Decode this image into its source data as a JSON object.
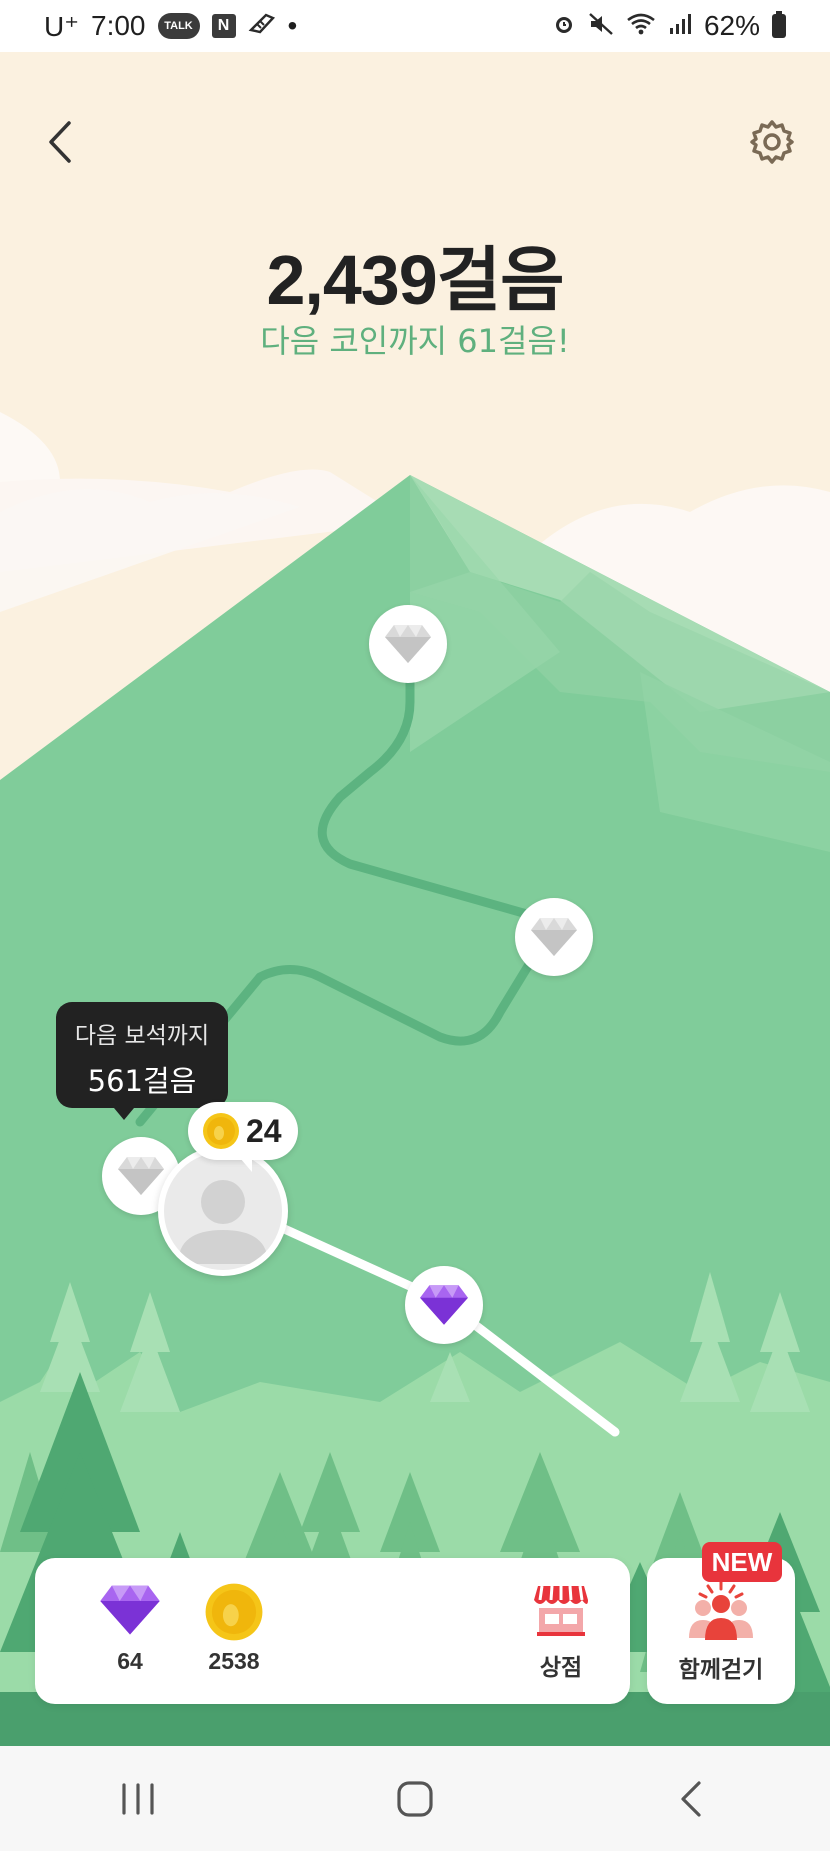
{
  "status_bar": {
    "carrier": "U⁺",
    "time": "7:00",
    "talk_badge": "TALK",
    "n_badge": "N",
    "dot": "•",
    "battery": "62%",
    "icons": [
      "talk-icon",
      "naver-icon",
      "shoe-icon",
      "alarm-icon",
      "mute-icon",
      "wifi-icon",
      "signal-icon",
      "battery-icon"
    ]
  },
  "header": {
    "steps_title": "2,439걸음",
    "steps_subtitle": "다음 코인까지 61걸음!"
  },
  "map": {
    "tooltip": {
      "line1": "다음 보석까지",
      "line2": "561걸음"
    },
    "coin_bubble_count": "24",
    "milestones": [
      "diamond-gray",
      "diamond-gray",
      "diamond-gray",
      "diamond-purple"
    ]
  },
  "bottom": {
    "gem_count": "64",
    "coin_count": "2538",
    "shop_label": "상점",
    "walk_together_label": "함께걷기",
    "new_badge": "NEW"
  },
  "colors": {
    "sky": "#fbf1e0",
    "mountain": "#80cc9a",
    "subtitle_green": "#5fb07e",
    "gem_purple": "#8e44e8",
    "coin_yellow": "#f5c518",
    "badge_red": "#e8343c"
  }
}
